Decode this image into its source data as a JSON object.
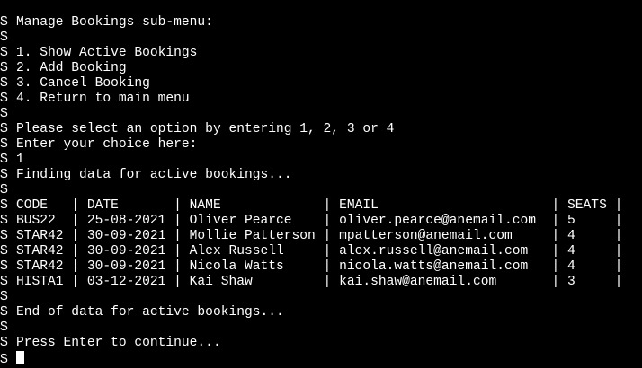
{
  "prompt_symbol": "$",
  "lines": [
    "Manage Bookings sub-menu:",
    "",
    "1. Show Active Bookings",
    "2. Add Booking",
    "3. Cancel Booking",
    "4. Return to main menu",
    "",
    "Please select an option by entering 1, 2, 3 or 4",
    "Enter your choice here:",
    "1",
    "Finding data for active bookings...",
    ""
  ],
  "table": {
    "header": "CODE   | DATE       | NAME             | EMAIL                      | SEATS |",
    "rows": [
      "BUS22  | 25-08-2021 | Oliver Pearce    | oliver.pearce@anemail.com  | 5     |",
      "STAR42 | 30-09-2021 | Mollie Patterson | mpatterson@anemail.com     | 4     |",
      "STAR42 | 30-09-2021 | Alex Russell     | alex.russell@anemail.com   | 4     |",
      "STAR42 | 30-09-2021 | Nicola Watts     | nicola.watts@anemail.com   | 4     |",
      "HISTA1 | 03-12-2021 | Kai Shaw         | kai.shaw@anemail.com       | 3     |"
    ]
  },
  "footer_lines": [
    "",
    "End of data for active bookings...",
    "",
    "Press Enter to continue..."
  ]
}
